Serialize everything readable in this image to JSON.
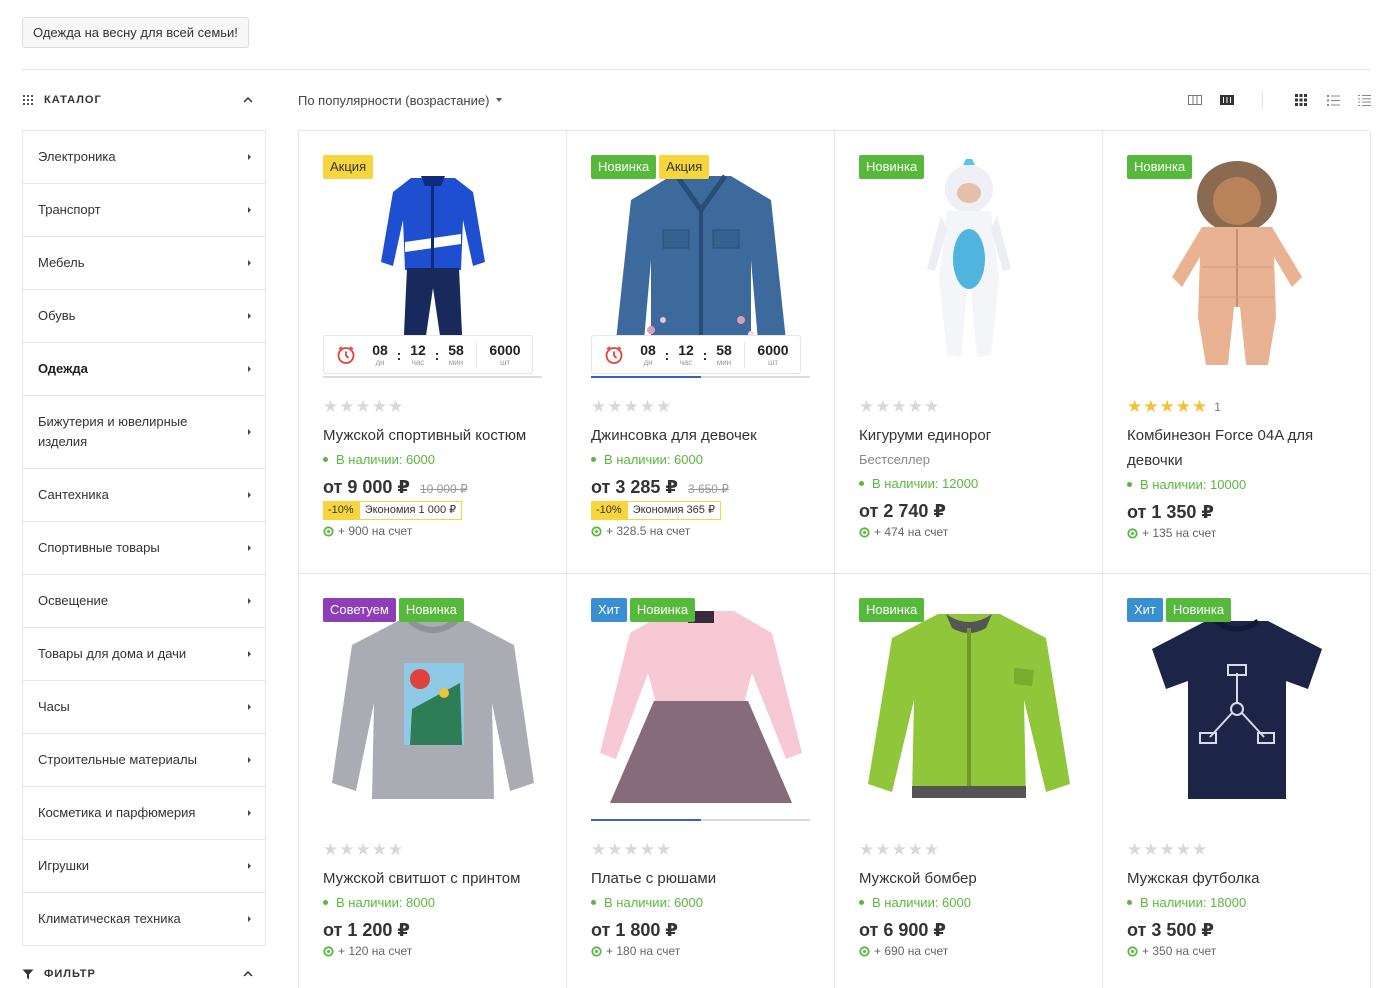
{
  "top_tag": "Одежда на весну для всей семьи!",
  "catalog_title": "КАТАЛОГ",
  "filter_title": "ФИЛЬТР",
  "categories": [
    {
      "label": "Электроника",
      "h": 53
    },
    {
      "label": "Транспорт",
      "h": 53
    },
    {
      "label": "Мебель",
      "h": 53
    },
    {
      "label": "Обувь",
      "h": 53
    },
    {
      "label": "Одежда",
      "h": 53,
      "active": true
    },
    {
      "label": "Бижутерия и ювелирные изделия",
      "h": 73
    },
    {
      "label": "Сантехника",
      "h": 53
    },
    {
      "label": "Спортивные товары",
      "h": 53
    },
    {
      "label": "Освещение",
      "h": 53
    },
    {
      "label": "Товары для дома и дачи",
      "h": 53
    },
    {
      "label": "Часы",
      "h": 53
    },
    {
      "label": "Строительные материалы",
      "h": 53
    },
    {
      "label": "Косметика и парфюмерия",
      "h": 53
    },
    {
      "label": "Игрушки",
      "h": 53
    },
    {
      "label": "Климатическая техника",
      "h": 53
    }
  ],
  "sort_label": "По популярности (возрастание)",
  "timer_units": {
    "d": "дн",
    "h": "час",
    "m": "мин",
    "q": "шт"
  },
  "products": [
    {
      "badges": [
        [
          "Акция",
          "b-akcia"
        ]
      ],
      "img": "tracksuit",
      "timer": {
        "d": "08",
        "h": "12",
        "m": "58",
        "q": "6000"
      },
      "progress": 0,
      "rating": 0,
      "rating_count": "",
      "title": "Мужской спортивный костюм",
      "subtitle": "",
      "stock": "В наличии: 6000",
      "price": "от 9 000 ₽",
      "old_price": "10 000 ₽",
      "discount_pct": "-10%",
      "discount_eco": "Экономия 1 000 ₽",
      "bonus": "+ 900 на счет"
    },
    {
      "badges": [
        [
          "Новинка",
          "b-new"
        ],
        [
          "Акция",
          "b-akcia"
        ]
      ],
      "img": "denim",
      "timer": {
        "d": "08",
        "h": "12",
        "m": "58",
        "q": "6000"
      },
      "progress": 0.5,
      "rating": 0,
      "rating_count": "",
      "title": "Джинсовка для девочек",
      "subtitle": "",
      "stock": "В наличии: 6000",
      "price": "от 3 285 ₽",
      "old_price": "3 650 ₽",
      "discount_pct": "-10%",
      "discount_eco": "Экономия 365 ₽",
      "bonus": "+ 328.5 на счет"
    },
    {
      "badges": [
        [
          "Новинка",
          "b-new"
        ]
      ],
      "img": "unicorn",
      "timer": null,
      "progress": null,
      "rating": 0,
      "rating_count": "",
      "title": "Кигуруми единорог",
      "subtitle": "Бестселлер",
      "stock": "В наличии: 12000",
      "price": "от 2 740 ₽",
      "old_price": "",
      "discount_pct": "",
      "discount_eco": "",
      "bonus": "+ 474 на счет"
    },
    {
      "badges": [
        [
          "Новинка",
          "b-new"
        ]
      ],
      "img": "overall",
      "timer": null,
      "progress": null,
      "rating": 5,
      "rating_count": "1",
      "title": "Комбинезон Force 04A для девочки",
      "subtitle": "",
      "stock": "В наличии: 10000",
      "price": "от 1 350 ₽",
      "old_price": "",
      "discount_pct": "",
      "discount_eco": "",
      "bonus": "+ 135 на счет"
    },
    {
      "badges": [
        [
          "Советуем",
          "b-sov"
        ],
        [
          "Новинка",
          "b-new"
        ]
      ],
      "img": "sweatshirt",
      "timer": null,
      "progress": null,
      "rating": 0,
      "rating_count": "",
      "title": "Мужской свитшот с принтом",
      "subtitle": "",
      "stock": "В наличии: 8000",
      "price": "от 1 200 ₽",
      "old_price": "",
      "discount_pct": "",
      "discount_eco": "",
      "bonus": "+ 120 на счет"
    },
    {
      "badges": [
        [
          "Хит",
          "b-hit"
        ],
        [
          "Новинка",
          "b-new"
        ]
      ],
      "img": "dress",
      "timer": null,
      "progress": 0.5,
      "rating": 0,
      "rating_count": "",
      "title": "Платье с рюшами",
      "subtitle": "",
      "stock": "В наличии: 6000",
      "price": "от 1 800 ₽",
      "old_price": "",
      "discount_pct": "",
      "discount_eco": "",
      "bonus": "+ 180 на счет"
    },
    {
      "badges": [
        [
          "Новинка",
          "b-new"
        ]
      ],
      "img": "bomber",
      "timer": null,
      "progress": null,
      "rating": 0,
      "rating_count": "",
      "title": "Мужской бомбер",
      "subtitle": "",
      "stock": "В наличии: 6000",
      "price": "от 6 900 ₽",
      "old_price": "",
      "discount_pct": "",
      "discount_eco": "",
      "bonus": "+ 690 на счет"
    },
    {
      "badges": [
        [
          "Хит",
          "b-hit"
        ],
        [
          "Новинка",
          "b-new"
        ]
      ],
      "img": "tshirt",
      "timer": null,
      "progress": null,
      "rating": 0,
      "rating_count": "",
      "title": "Мужская футболка",
      "subtitle": "",
      "stock": "В наличии: 18000",
      "price": "от 3 500 ₽",
      "old_price": "",
      "discount_pct": "",
      "discount_eco": "",
      "bonus": "+ 350 на счет"
    }
  ]
}
